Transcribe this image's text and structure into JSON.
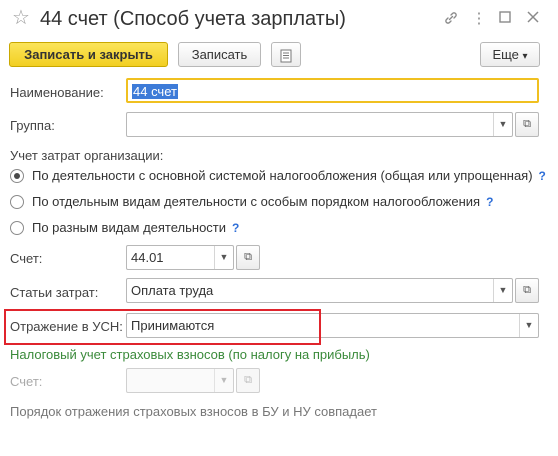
{
  "window": {
    "title": "44 счет (Способ учета зарплаты)",
    "icons": [
      "star-icon",
      "link-icon",
      "more-vertical-icon",
      "maximize-icon",
      "close-icon"
    ]
  },
  "toolbar": {
    "save_close_label": "Записать и закрыть",
    "save_label": "Записать",
    "more_label": "Еще",
    "more_arrow": "▾"
  },
  "form": {
    "name_label": "Наименование:",
    "name_value": "44 счет",
    "group_label": "Группа:",
    "group_value": "",
    "cost_section_label": "Учет затрат организации:",
    "radios": [
      {
        "label": "По деятельности с основной системой налогообложения (общая или упрощенная)",
        "checked": true,
        "help": "?"
      },
      {
        "label": "По отдельным видам деятельности с особым порядком налогообложения",
        "checked": false,
        "help": "?"
      },
      {
        "label": "По разным видам деятельности",
        "checked": false,
        "help": "?"
      }
    ],
    "account_label": "Счет:",
    "account_value": "44.01",
    "cost_items_label": "Статьи затрат:",
    "cost_items_value": "Оплата труда",
    "usn_label": "Отражение в УСН:",
    "usn_value": "Принимаются",
    "tax_section_label": "Налоговый учет страховых взносов (по налогу на прибыль)",
    "tax_account_label": "Счет:",
    "tax_account_value": "",
    "note": "Порядок отражения страховых взносов в БУ и НУ совпадает"
  },
  "colors": {
    "primary_button": "#f2cf22",
    "highlight_border": "#e0242c",
    "section_green": "#3a8a3a",
    "help_blue": "#2f6fd8",
    "focus_border": "#f0c020"
  }
}
